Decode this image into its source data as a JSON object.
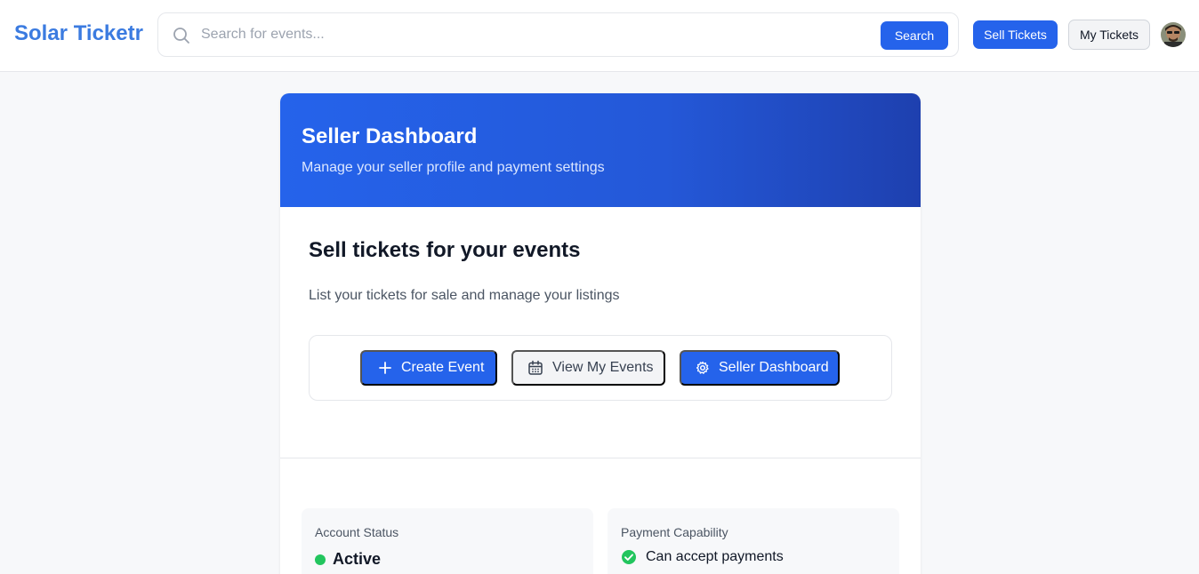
{
  "header": {
    "logo": "Solar Ticketr",
    "search_placeholder": "Search for events...",
    "search_button": "Search",
    "sell_tickets_button": "Sell Tickets",
    "my_tickets_button": "My Tickets"
  },
  "hero": {
    "title": "Seller Dashboard",
    "subtitle": "Manage your seller profile and payment settings"
  },
  "section": {
    "title": "Sell tickets for your events",
    "subtitle": "List your tickets for sale and manage your listings"
  },
  "actions": {
    "create_event": "Create Event",
    "view_events": "View My Events",
    "seller_dashboard": "Seller Dashboard"
  },
  "account_status": {
    "label": "Account Status",
    "value": "Active"
  },
  "payment_capability": {
    "label": "Payment Capability",
    "value": "Can accept payments"
  },
  "colors": {
    "accent": "#2563eb",
    "logo": "#3b7be0",
    "status_active": "#22c55e"
  },
  "icons": [
    "search-icon",
    "plus-icon",
    "calendar-icon",
    "gear-icon",
    "check-circle-icon"
  ]
}
